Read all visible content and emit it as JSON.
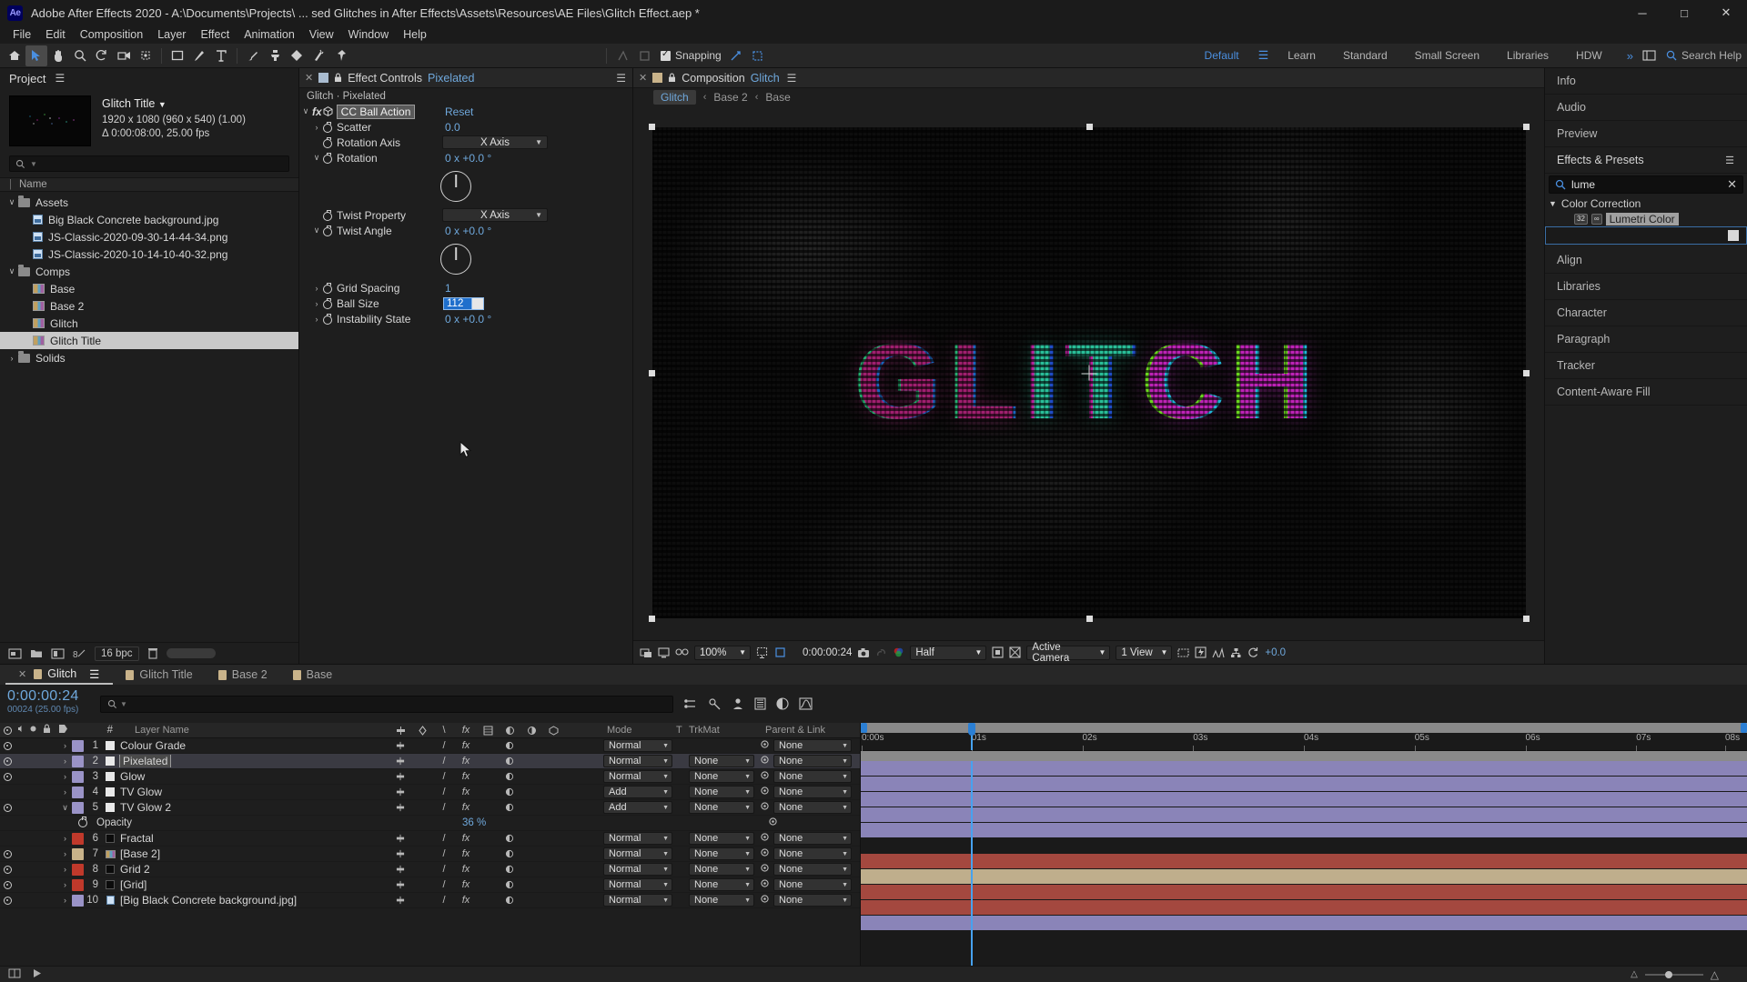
{
  "titlebar": {
    "logo": "Ae",
    "title": "Adobe After Effects 2020 - A:\\Documents\\Projects\\ ... sed Glitches in After Effects\\Assets\\Resources\\AE Files\\Glitch Effect.aep *",
    "minimize": "─",
    "maximize": "□",
    "close": "✕"
  },
  "menubar": [
    "File",
    "Edit",
    "Composition",
    "Layer",
    "Effect",
    "Animation",
    "View",
    "Window",
    "Help"
  ],
  "toolbar": {
    "snapping_label": "Snapping",
    "workspaces": [
      "Default",
      "Learn",
      "Standard",
      "Small Screen",
      "Libraries",
      "HDW"
    ],
    "selected_workspace": "Default",
    "overflow": "»",
    "search_help": "Search Help"
  },
  "project": {
    "title": "Project",
    "item": {
      "name": "Glitch Title",
      "dimensions": "1920 x 1080  (960 x 540) (1.00)",
      "duration": "Δ 0:00:08:00, 25.00 fps"
    },
    "column_header": "Name",
    "rows": [
      {
        "label": "Assets",
        "type": "folder",
        "indent": 0,
        "twirl": "∨",
        "selected": false
      },
      {
        "label": "Big Black Concrete background.jpg",
        "type": "image",
        "indent": 1,
        "twirl": "",
        "selected": false
      },
      {
        "label": "JS-Classic-2020-09-30-14-44-34.png",
        "type": "image",
        "indent": 1,
        "twirl": "",
        "selected": false
      },
      {
        "label": "JS-Classic-2020-10-14-10-40-32.png",
        "type": "image",
        "indent": 1,
        "twirl": "",
        "selected": false
      },
      {
        "label": "Comps",
        "type": "folder",
        "indent": 0,
        "twirl": "∨",
        "selected": false
      },
      {
        "label": "Base",
        "type": "comp",
        "indent": 1,
        "twirl": "",
        "selected": false
      },
      {
        "label": "Base 2",
        "type": "comp",
        "indent": 1,
        "twirl": "",
        "selected": false
      },
      {
        "label": "Glitch",
        "type": "comp",
        "indent": 1,
        "twirl": "",
        "selected": false
      },
      {
        "label": "Glitch Title",
        "type": "comp",
        "indent": 1,
        "twirl": "",
        "selected": true
      },
      {
        "label": "Solids",
        "type": "folder",
        "indent": 0,
        "twirl": "›",
        "selected": false
      }
    ],
    "bpc": "16 bpc"
  },
  "effect_controls": {
    "tab_label": "Effect Controls",
    "tab_target": "Pixelated",
    "breadcrumb": "Glitch · Pixelated",
    "effect_name": "CC Ball Action",
    "reset_label": "Reset",
    "properties": [
      {
        "name": "Scatter",
        "value": "0.0",
        "type": "number",
        "twirl": "›"
      },
      {
        "name": "Rotation Axis",
        "value": "X Axis",
        "type": "dropdown",
        "twirl": ""
      },
      {
        "name": "Rotation",
        "value": "0 x +0.0 °",
        "type": "angle",
        "twirl": "∨"
      },
      {
        "name": "Twist Property",
        "value": "X Axis",
        "type": "dropdown",
        "twirl": ""
      },
      {
        "name": "Twist Angle",
        "value": "0 x +0.0 °",
        "type": "angle",
        "twirl": "∨"
      },
      {
        "name": "Grid Spacing",
        "value": "1",
        "type": "number",
        "twirl": "›"
      },
      {
        "name": "Ball Size",
        "value": "112",
        "type": "editing",
        "twirl": "›"
      },
      {
        "name": "Instability State",
        "value": "0 x +0.0 °",
        "type": "number",
        "twirl": "›"
      }
    ]
  },
  "composition": {
    "tab_label": "Composition",
    "tab_target": "Glitch",
    "breadcrumbs": [
      "Glitch",
      "Base 2",
      "Base"
    ],
    "breadcrumb_sep": "‹",
    "selected_breadcrumb": "Glitch",
    "canvas_text": "GLITCH",
    "bottom_bar": {
      "zoom": "100%",
      "time": "0:00:00:24",
      "resolution": "Half",
      "camera": "Active Camera",
      "views": "1 View",
      "exposure": "+0.0"
    }
  },
  "rail": {
    "items": [
      {
        "label": "Info",
        "type": "panel"
      },
      {
        "label": "Audio",
        "type": "panel"
      },
      {
        "label": "Preview",
        "type": "panel"
      },
      {
        "label": "Effects & Presets",
        "type": "panel-open"
      }
    ],
    "effects_search_value": "lume",
    "effects_category": "Color Correction",
    "effects_result": "Lumetri Color",
    "badge_32": "32",
    "badge_fp": "∞",
    "bottom_items": [
      {
        "label": "Align"
      },
      {
        "label": "Libraries"
      },
      {
        "label": "Character"
      },
      {
        "label": "Paragraph"
      },
      {
        "label": "Tracker"
      },
      {
        "label": "Content-Aware Fill"
      }
    ]
  },
  "timeline": {
    "tabs": [
      {
        "label": "Glitch",
        "selected": true
      },
      {
        "label": "Glitch Title",
        "selected": false
      },
      {
        "label": "Base 2",
        "selected": false
      },
      {
        "label": "Base",
        "selected": false
      }
    ],
    "current_time": "0:00:00:24",
    "frame_info": "00024 (25.00 fps)",
    "columns": {
      "hash": "#",
      "layer_name": "Layer Name",
      "mode": "Mode",
      "t": "T",
      "trkmat": "TrkMat",
      "parent": "Parent & Link"
    },
    "layers": [
      {
        "num": "1",
        "name": "Colour Grade",
        "mode": "Normal",
        "trkmat": "",
        "parent": "None",
        "color": "#9a93c7",
        "src": "white",
        "eye": true,
        "selected": false,
        "twirl": "›"
      },
      {
        "num": "2",
        "name": "Pixelated",
        "mode": "Normal",
        "trkmat": "None",
        "parent": "None",
        "color": "#9a93c7",
        "src": "white",
        "eye": true,
        "selected": true,
        "twirl": "›"
      },
      {
        "num": "3",
        "name": "Glow",
        "mode": "Normal",
        "trkmat": "None",
        "parent": "None",
        "color": "#9a93c7",
        "src": "white",
        "eye": true,
        "selected": false,
        "twirl": "›"
      },
      {
        "num": "4",
        "name": "TV Glow",
        "mode": "Add",
        "trkmat": "None",
        "parent": "None",
        "color": "#9a93c7",
        "src": "white",
        "eye": false,
        "selected": false,
        "twirl": "›"
      },
      {
        "num": "5",
        "name": "TV Glow 2",
        "mode": "Add",
        "trkmat": "None",
        "parent": "None",
        "color": "#9a93c7",
        "src": "white",
        "eye": true,
        "selected": false,
        "twirl": "∨"
      },
      {
        "num": "6",
        "name": "Fractal",
        "mode": "Normal",
        "trkmat": "None",
        "parent": "None",
        "color": "#c0392b",
        "src": "black",
        "eye": false,
        "selected": false,
        "twirl": "›"
      },
      {
        "num": "7",
        "name": "[Base 2]",
        "mode": "Normal",
        "trkmat": "None",
        "parent": "None",
        "color": "#c9b38a",
        "src": "comp",
        "eye": true,
        "selected": false,
        "twirl": "›"
      },
      {
        "num": "8",
        "name": "Grid 2",
        "mode": "Normal",
        "trkmat": "None",
        "parent": "None",
        "color": "#c0392b",
        "src": "black",
        "eye": true,
        "selected": false,
        "twirl": "›"
      },
      {
        "num": "9",
        "name": "[Grid]",
        "mode": "Normal",
        "trkmat": "None",
        "parent": "None",
        "color": "#c0392b",
        "src": "black",
        "eye": true,
        "selected": false,
        "twirl": "›"
      },
      {
        "num": "10",
        "name": "[Big Black Concrete background.jpg]",
        "mode": "Normal",
        "trkmat": "None",
        "parent": "None",
        "color": "#9a93c7",
        "src": "image",
        "eye": true,
        "selected": false,
        "twirl": "›"
      }
    ],
    "opacity_property": {
      "name": "Opacity",
      "value": "36 %"
    },
    "ruler_ticks": [
      "0:00s",
      "01s",
      "02s",
      "03s",
      "04s",
      "05s",
      "06s",
      "07s",
      "08s"
    ]
  }
}
